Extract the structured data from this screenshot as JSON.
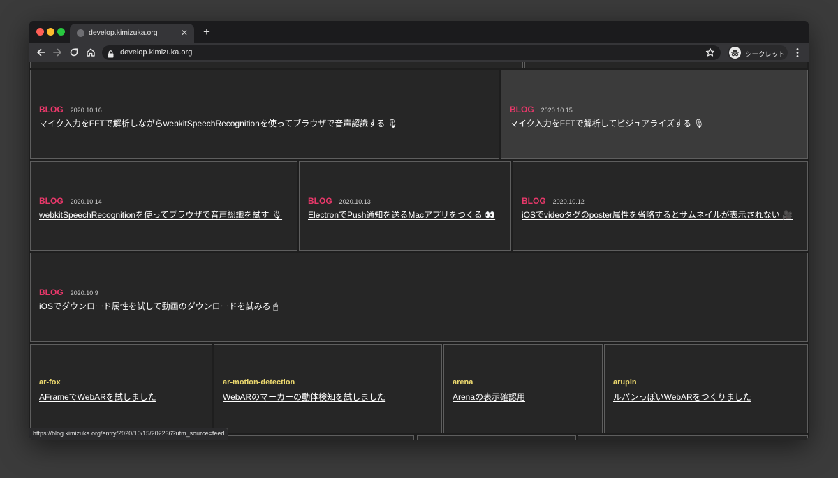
{
  "browser": {
    "tab_title": "develop.kimizuka.org",
    "tab_close": "✕",
    "new_tab": "+",
    "url": "develop.kimizuka.org",
    "incognito_label": "シークレット",
    "status_url": "https://blog.kimizuka.org/entry/2020/10/15/202236?utm_source=feed",
    "icons": [
      "back-icon",
      "forward-icon",
      "reload-icon",
      "home-icon",
      "lock-icon",
      "star-icon",
      "incognito-icon",
      "menu-icon"
    ]
  },
  "posts": [
    {
      "category": "BLOG",
      "date": "2020.10.16",
      "title": "マイク入力をFFTで解析しながらwebkitSpeechRecognitionを使ってブラウザで音声認識する 🎙"
    },
    {
      "category": "BLOG",
      "date": "2020.10.15",
      "title": "マイク入力をFFTで解析してビジュアライズする 🎙"
    },
    {
      "category": "BLOG",
      "date": "2020.10.14",
      "title": "webkitSpeechRecognitionを使ってブラウザで音声認識を試す 🎙"
    },
    {
      "category": "BLOG",
      "date": "2020.10.13",
      "title": "ElectronでPush通知を送るMacアプリをつくる 👀"
    },
    {
      "category": "BLOG",
      "date": "2020.10.12",
      "title": "iOSでvideoタグのposter属性を省略するとサムネイルが表示されない 🎥"
    },
    {
      "category": "BLOG",
      "date": "2020.10.9",
      "title": "iOSでダウンロード属性を試して動画のダウンロードを試みる 🖱"
    }
  ],
  "repos": [
    {
      "name": "ar-fox",
      "title": "AFrameでWebARを試しました"
    },
    {
      "name": "ar-motion-detection",
      "title": "WebARのマーカーの動体検知を試しました"
    },
    {
      "name": "arena",
      "title": "Arenaの表示確認用"
    },
    {
      "name": "arupin",
      "title": "ルパンっぽいWebARをつくりました"
    }
  ],
  "colors": {
    "category": "#e8386a",
    "repo": "#ecd86e",
    "card_bg": "#262626",
    "card_hover_bg": "#3b3b3b",
    "card_border": "#5e5e5e"
  }
}
